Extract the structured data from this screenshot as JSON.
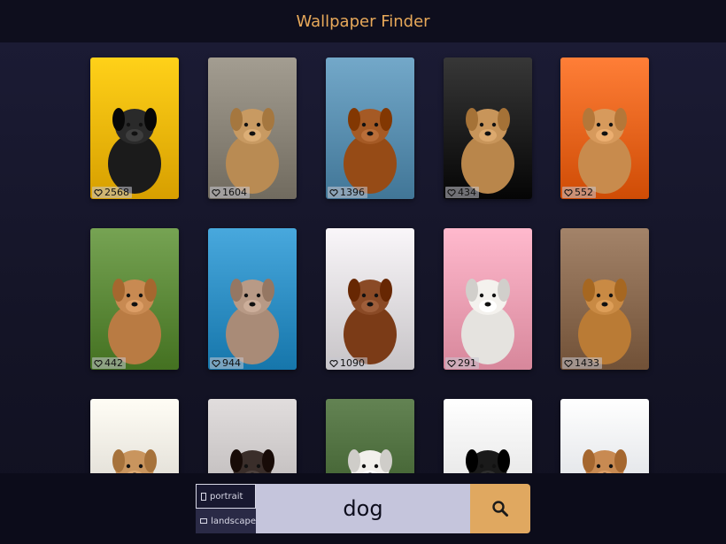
{
  "app": {
    "title": "Wallpaper Finder"
  },
  "colors": {
    "accent": "#e0a860",
    "title": "#e8a95a",
    "background": "#141426"
  },
  "wallpapers": [
    {
      "likes": "2568",
      "bg": "#f0b800",
      "dog": "#2a2a2a",
      "subject": "pug in sweater"
    },
    {
      "likes": "1604",
      "bg": "#8a8478",
      "dog": "#c89a62",
      "subject": "golden retriever with rose"
    },
    {
      "likes": "1396",
      "bg": "#5a8fb0",
      "dog": "#a55a25",
      "subject": "dog running on beach"
    },
    {
      "likes": "434",
      "bg": "#1e1e1e",
      "dog": "#c8955a",
      "subject": "labrador on dark background"
    },
    {
      "likes": "552",
      "bg": "#e8651e",
      "dog": "#d79a5c",
      "subject": "corgi puppy on orange"
    },
    {
      "likes": "442",
      "bg": "#5d8a3a",
      "dog": "#c88a52",
      "subject": "dog lying in grass"
    },
    {
      "likes": "944",
      "bg": "#2f8fc4",
      "dog": "#b89a86",
      "subject": "french bulldog in yellow hoodie"
    },
    {
      "likes": "1090",
      "bg": "#e0dde0",
      "dog": "#8a4a26",
      "subject": "cavalier puppy on blanket"
    },
    {
      "likes": "291",
      "bg": "#f0a0b4",
      "dog": "#f4f2ee",
      "subject": "samoyed on pink"
    },
    {
      "likes": "1433",
      "bg": "#8a6a50",
      "dog": "#c98a44",
      "subject": "golden retriever with flower"
    },
    {
      "likes": "",
      "bg": "#e8e4dc",
      "dog": "#c9955e",
      "subject": "poodle with decorations"
    },
    {
      "likes": "",
      "bg": "#c8c4c4",
      "dog": "#3a2e2a",
      "subject": "small dog on sofa"
    },
    {
      "likes": "",
      "bg": "#4a6a3a",
      "dog": "#f2f0ec",
      "subject": "samoyed outdoors"
    },
    {
      "likes": "",
      "bg": "#f0f0f0",
      "dog": "#1a1a1a",
      "subject": "pug with glasses"
    },
    {
      "likes": "",
      "bg": "#e8ecf2",
      "dog": "#c88a52",
      "subject": "corgi in white"
    }
  ],
  "orientation": {
    "portrait": {
      "label": "portrait",
      "icon": "portrait-icon",
      "active": true
    },
    "landscape": {
      "label": "landscape",
      "icon": "landscape-icon",
      "active": false
    }
  },
  "search": {
    "value": "dog",
    "icon": "search-icon"
  }
}
